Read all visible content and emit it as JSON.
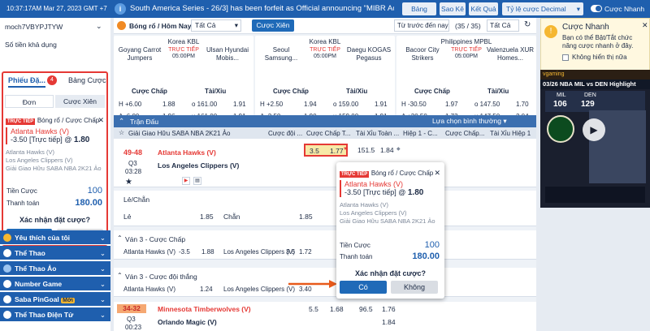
{
  "topbar": {
    "datetime": "10:37:17AM Mar 27, 2023 GMT +7",
    "announcement": "South America Series - 26/3] has been forfeit as Official announcing \"MIBR Academy\" as",
    "btn_bet_list": "Bảng Cược",
    "btn_statement": "Sao Kê",
    "btn_results": "Kết Quả",
    "odds_type": "Tỷ lệ cược Decimal",
    "quick_bet": "Cược Nhanh"
  },
  "sidebar": {
    "username": "moch7VBYPJTYW",
    "balance_label": "Số tiền khả dụng",
    "tab_slip": "Phiếu Đặ...",
    "tab_count": "4",
    "tab_betlist": "Bảng Cược",
    "subtab_single": "Đơn",
    "subtab_parlay": "Cược Xiên",
    "slip": {
      "live_tag": "TRỰC TIẾP",
      "sport": "Bóng rổ / Cược Chấp",
      "selection": "Atlanta Hawks (V)",
      "line": "-3.50 [Trực tiếp] @",
      "odds": "1.80",
      "team1": "Atlanta Hawks (V)",
      "team2": "Los Angeles Clippers (V)",
      "league": "Giải Giao Hữu SABA NBA 2K21 Ảo",
      "stake_label": "Tiền Cược",
      "stake": "100",
      "payout_label": "Thanh toán",
      "payout": "180.00",
      "confirm": "Xác nhận đặt cược?",
      "yes": "Có",
      "no": "Không"
    },
    "menu": [
      "Yêu thích của tôi",
      "Thể Thao",
      "Thể Thao Ảo",
      "Number Game",
      "Saba PinGoal",
      "Thể Thao Điện Tử"
    ],
    "menu_badge": "Mới"
  },
  "filter": {
    "sport": "Bóng rổ / Hôm Nay",
    "all": "Tất Cả",
    "parlay": "Cược Xiên",
    "sort": "Từ trước đến nay",
    "count": "(35 / 35)",
    "all2": "Tất Cả"
  },
  "cards": [
    {
      "league": "Korea KBL",
      "home": "Goyang Carrot Jumpers",
      "away": "Ulsan Hyundai Mobis...",
      "live": "TRỰC TIẾP",
      "time": "05:00PM",
      "hdp": "Cược Chấp",
      "ou": "Tài/Xỉu",
      "r1": [
        "H +6.00",
        "1.88",
        "o 161.00",
        "1.91"
      ],
      "r2": [
        "A -6.00",
        "1.96",
        "u 161.00",
        "1.91"
      ]
    },
    {
      "league": "Korea KBL",
      "home": "Seoul Samsung...",
      "away": "Daegu KOGAS Pegasus",
      "live": "TRỰC TIẾP",
      "time": "05:00PM",
      "hdp": "Cược Chấp",
      "ou": "Tài/Xỉu",
      "r1": [
        "H +2.50",
        "1.94",
        "o 159.00",
        "1.91"
      ],
      "r2": [
        "A -2.50",
        "1.90",
        "u 159.00",
        "1.91"
      ]
    },
    {
      "league": "Philippines MPBL",
      "home": "Bacoor City Strikers",
      "away": "Valenzuela XUR Homes...",
      "live": "TRỰC TIẾP",
      "time": "05:00PM",
      "hdp": "Cược Chấp",
      "ou": "Tài/Xỉu",
      "r1": [
        "H -30.50",
        "1.97",
        "o 147.50",
        "1.70"
      ],
      "r2": [
        "A +30.50",
        "1.73",
        "u 147.50",
        "2.04"
      ]
    }
  ],
  "table": {
    "section": "Trận Đấu",
    "choose": "Lựa chọn bình thường",
    "league": "Giải Giao Hữu SABA NBA 2K21 Ảo",
    "cols": [
      "Cược đội ...",
      "Cược Chấp T...",
      "Tài Xỉu Toàn ...",
      "Hiệp 1 - C...",
      "Cược Chấp...",
      "Tài Xỉu Hiệp 1"
    ],
    "m1": {
      "score": "49-48",
      "q": "Q3",
      "clock": "03:28",
      "home": "Atlanta Hawks (V)",
      "away": "Los Angeles Clippers (V)",
      "hdp": "3.5",
      "hdp_odds": "1.77",
      "ou": "151.5",
      "ou_odds": "1.84"
    },
    "oe": {
      "title": "Lẻ/Chẵn",
      "odd": "Lẻ",
      "odd_v": "1.85",
      "even": "Chẵn",
      "even_v": "1.85"
    },
    "r3": {
      "title": "Ván 3 - Cược Chấp",
      "t1": "Atlanta Hawks (V)",
      "l1": "-3.5",
      "v1": "1.88",
      "t2": "Los Angeles Clippers (V)",
      "l2": "3.5",
      "v2": "1.72"
    },
    "r4": {
      "title": "Ván 3 - Cược đội thắng",
      "t1": "Atlanta Hawks (V)",
      "v1": "1.24",
      "t2": "Los Angeles Clippers (V)",
      "v2": "3.40"
    },
    "m2": {
      "score": "34-32",
      "q": "Q3",
      "clock": "00:23",
      "home": "Minnesota Timberwolves (V)",
      "away": "Orlando Magic (V)",
      "hdp": "5.5",
      "hdp_odds": "1.68",
      "ou": "96.5",
      "ou_odds": "1.76",
      "ou2_odds": "1.84"
    }
  },
  "qbet": {
    "title": "Cược Nhanh",
    "text": "Bạn có thể Bật/Tắt chức năng cược nhanh ở đây.",
    "dont_show": "Không hiển thị nữa"
  },
  "ad": {
    "title": "03/26 NBA MIL vs DEN Highlight",
    "mil": "MIL",
    "den": "DEN",
    "s1": "106",
    "s2": "129",
    "brand": "vgaming"
  }
}
